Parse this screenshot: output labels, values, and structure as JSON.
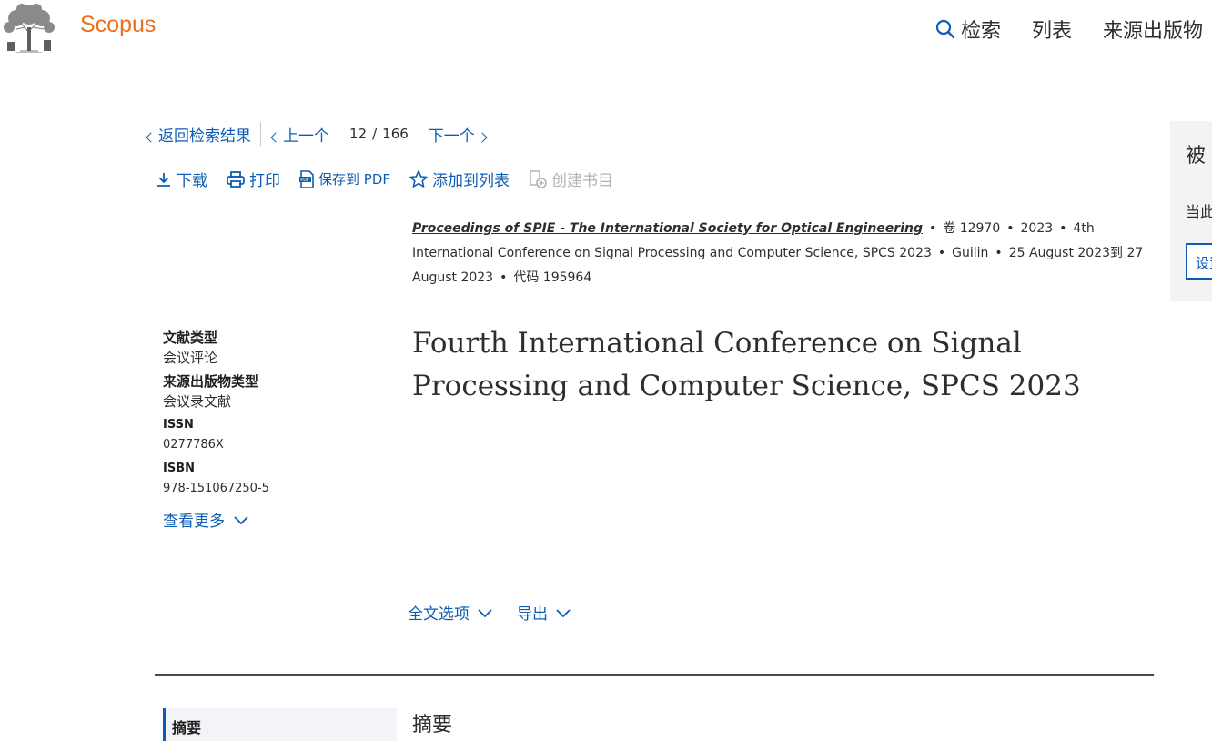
{
  "header": {
    "brand": "Scopus",
    "nav": {
      "search_label": "检索",
      "lists_label": "列表",
      "sources_label": "来源出版物"
    }
  },
  "results_nav": {
    "back_label": "返回检索结果",
    "prev_label": "上一个",
    "current": "12",
    "separator": "/",
    "total": "166",
    "next_label": "下一个"
  },
  "actions": {
    "download": "下载",
    "print": "打印",
    "save_pdf": "保存到 PDF",
    "add_to_list": "添加到列表",
    "create_bib": "创建书目"
  },
  "source": {
    "journal": "Proceedings of SPIE - The International Society for Optical Engineering",
    "volume": "卷 12970",
    "year": "2023",
    "conference": "4th International Conference on Signal Processing and Computer Science, SPCS 2023",
    "location": "Guilin",
    "dates": "25 August 2023到 27 August 2023",
    "code": "代码 195964"
  },
  "meta": {
    "doc_type_label": "文献类型",
    "doc_type_value": "会议评论",
    "source_type_label": "来源出版物类型",
    "source_type_value": "会议录文献",
    "issn_label": "ISSN",
    "issn_value": "0277786X",
    "isbn_label": "ISBN",
    "isbn_value": "978-151067250-5",
    "more_label": "查看更多"
  },
  "document": {
    "title": "Fourth International Conference on Signal Processing and Computer Science, SPCS 2023",
    "full_text_label": "全文选项",
    "export_label": "导出"
  },
  "sections": {
    "toc_abstract": "摘要",
    "abstract_heading": "摘要"
  },
  "side_panel": {
    "title": "被",
    "subtitle": "当此",
    "button": "设置"
  },
  "colors": {
    "brand": "#e9711c",
    "link": "#0e5db5",
    "text": "#2e2e2e"
  }
}
